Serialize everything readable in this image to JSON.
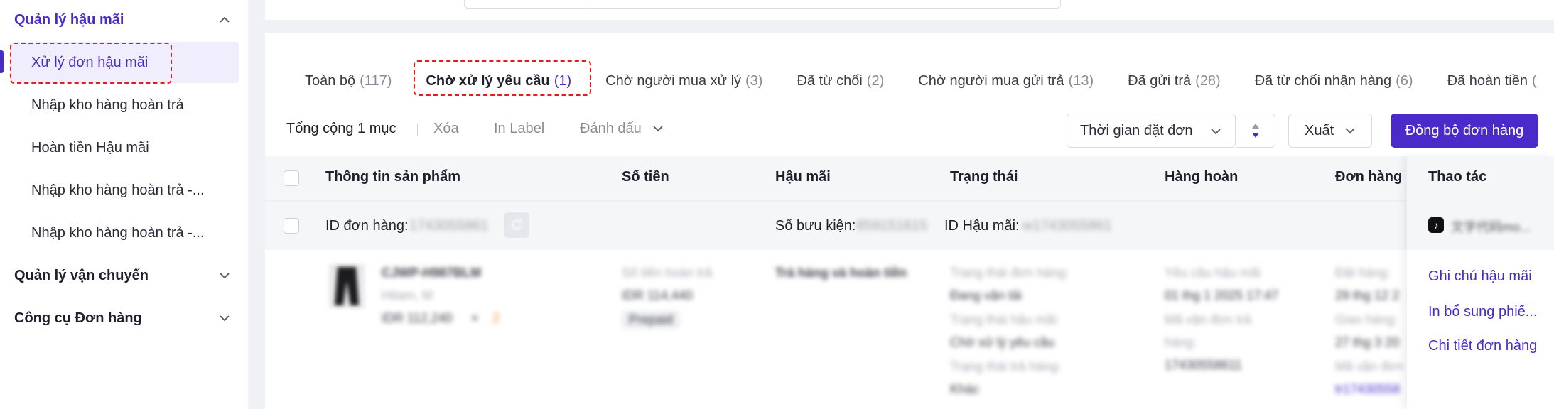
{
  "sidebar": {
    "group_after_sales": "Quản lý hậu mãi",
    "items": [
      "Xử lý đơn hậu mãi",
      "Nhập kho hàng hoàn trả",
      "Hoàn tiền Hậu mãi",
      "Nhập kho hàng hoàn trả -...",
      "Nhập kho hàng hoàn trả -..."
    ],
    "group_shipping": "Quản lý vận chuyển",
    "group_tools": "Công cụ Đơn hàng"
  },
  "tabs": [
    {
      "label": "Toàn bộ",
      "count": "(117)"
    },
    {
      "label": "Chờ xử lý yêu cầu",
      "count": "(1)"
    },
    {
      "label": "Chờ người mua xử lý",
      "count": "(3)"
    },
    {
      "label": "Đã từ chối",
      "count": "(2)"
    },
    {
      "label": "Chờ người mua gửi trả",
      "count": "(13)"
    },
    {
      "label": "Đã gửi trả",
      "count": "(28)"
    },
    {
      "label": "Đã từ chối nhận hàng",
      "count": "(6)"
    },
    {
      "label": "Đã hoàn tiền",
      "count": "("
    }
  ],
  "toolbar": {
    "total": "Tổng cộng 1 mục",
    "delete": "Xóa",
    "print_label": "In Label",
    "mark": "Đánh dấu",
    "time_select": "Thời gian đặt đơn",
    "export": "Xuất",
    "sync": "Đồng bộ đơn hàng"
  },
  "table": {
    "headers": {
      "product": "Thông tin sản phẩm",
      "amount": "Số tiền",
      "after_sales": "Hậu mãi",
      "status": "Trạng thái",
      "return_goods": "Hàng hoàn",
      "order": "Đơn hàng",
      "actions": "Thao tác"
    },
    "order_row": {
      "order_id_label": "ID đơn hàng:",
      "order_id_value": "1743055861",
      "parcel_label": "Số bưu kiện:",
      "parcel_value": "859151615",
      "after_sales_id_label": "ID Hậu mãi:",
      "after_sales_id_value": "w1743055861",
      "shop_name": "文字代码mo..."
    },
    "detail": {
      "sku": "CJWP-H987BLM",
      "variant": "Hitam, M",
      "price": "IDR 112,240",
      "times": "×",
      "qty": "2",
      "refund_label": "Số tiền hoàn trả",
      "refund_value": "IDR 114,440",
      "payment": "Prepaid",
      "after_sales_type": "Trả hàng và hoàn tiền",
      "order_status_label": "Trạng thái đơn hàng:",
      "order_status_value": "Đang vận tải",
      "as_status_label": "Trạng thái hậu mãi:",
      "as_status_value": "Chờ xử lý yêu cầu",
      "return_status_label": "Trạng thái trả hàng:",
      "return_status_value": "Khác",
      "request_label": "Yêu cầu hậu mãi",
      "request_value": "01 thg 1 2025 17:47",
      "tracking_label": "Mã vận đơn trả",
      "tracking_label2": "hàng:",
      "tracking_value": "17430558611",
      "ordered_label": "Đặt hàng:",
      "ordered_value": "29 thg 12 2",
      "delivered_label": "Giao hàng:",
      "delivered_value": "27 thg 3 20",
      "order_tracking_label": "Mã vận đơn",
      "order_tracking_value": "tr17430558"
    },
    "actions": {
      "note": "Ghi chú hậu mãi",
      "print_extra": "In bổ sung phiế...",
      "order_detail": "Chi tiết đơn hàng"
    }
  }
}
